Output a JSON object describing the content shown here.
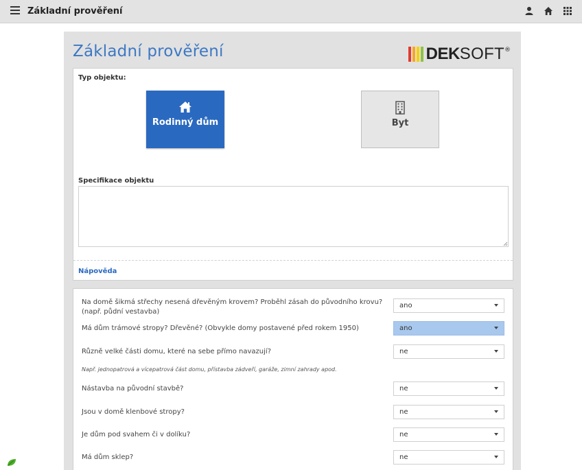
{
  "topbar": {
    "title": "Základní prověření"
  },
  "header": {
    "title": "Základní prověření"
  },
  "logo": {
    "part_bold": "DEK",
    "part_light": "SOFT",
    "mark": "®"
  },
  "colors": {
    "accent": "#2a69c0",
    "title": "#3d78c4",
    "highlight": "#a9c8ee",
    "logo_bars": [
      "#e13a2f",
      "#f5a623",
      "#f5d000",
      "#8fc23f"
    ]
  },
  "object_type": {
    "label": "Typ objektu:",
    "options": [
      {
        "label": "Rodinný dům",
        "icon": "house-icon",
        "selected": true
      },
      {
        "label": "Byt",
        "icon": "building-icon",
        "selected": false
      }
    ]
  },
  "specification": {
    "label": "Specifikace objektu",
    "value": ""
  },
  "help": {
    "label": "Nápověda"
  },
  "questions": [
    {
      "text": "Na domě šikmá střechy nesená dřevěným krovem? Proběhl zásah do původního krovu? (např. půdní vestavba)",
      "value": "ano",
      "highlighted": false
    },
    {
      "text": "Má dům trámové stropy? Dřevěné? (Obvykle domy postavené před rokem 1950)",
      "value": "ano",
      "highlighted": true
    },
    {
      "text": "Různě velké části domu, které na sebe přímo navazují?",
      "value": "ne",
      "highlighted": false,
      "note": "Např. jednopatrová a vícepatrová část domu, přístavba zádveří, garáže, zimní zahrady apod."
    },
    {
      "text": "Nástavba na původní stavbě?",
      "value": "ne",
      "highlighted": false
    },
    {
      "text": "Jsou v domě klenbové stropy?",
      "value": "ne",
      "highlighted": false
    },
    {
      "text": "Je dům pod svahem či v dolíku?",
      "value": "ne",
      "highlighted": false
    },
    {
      "text": "Má dům sklep?",
      "value": "ne",
      "highlighted": false
    }
  ]
}
